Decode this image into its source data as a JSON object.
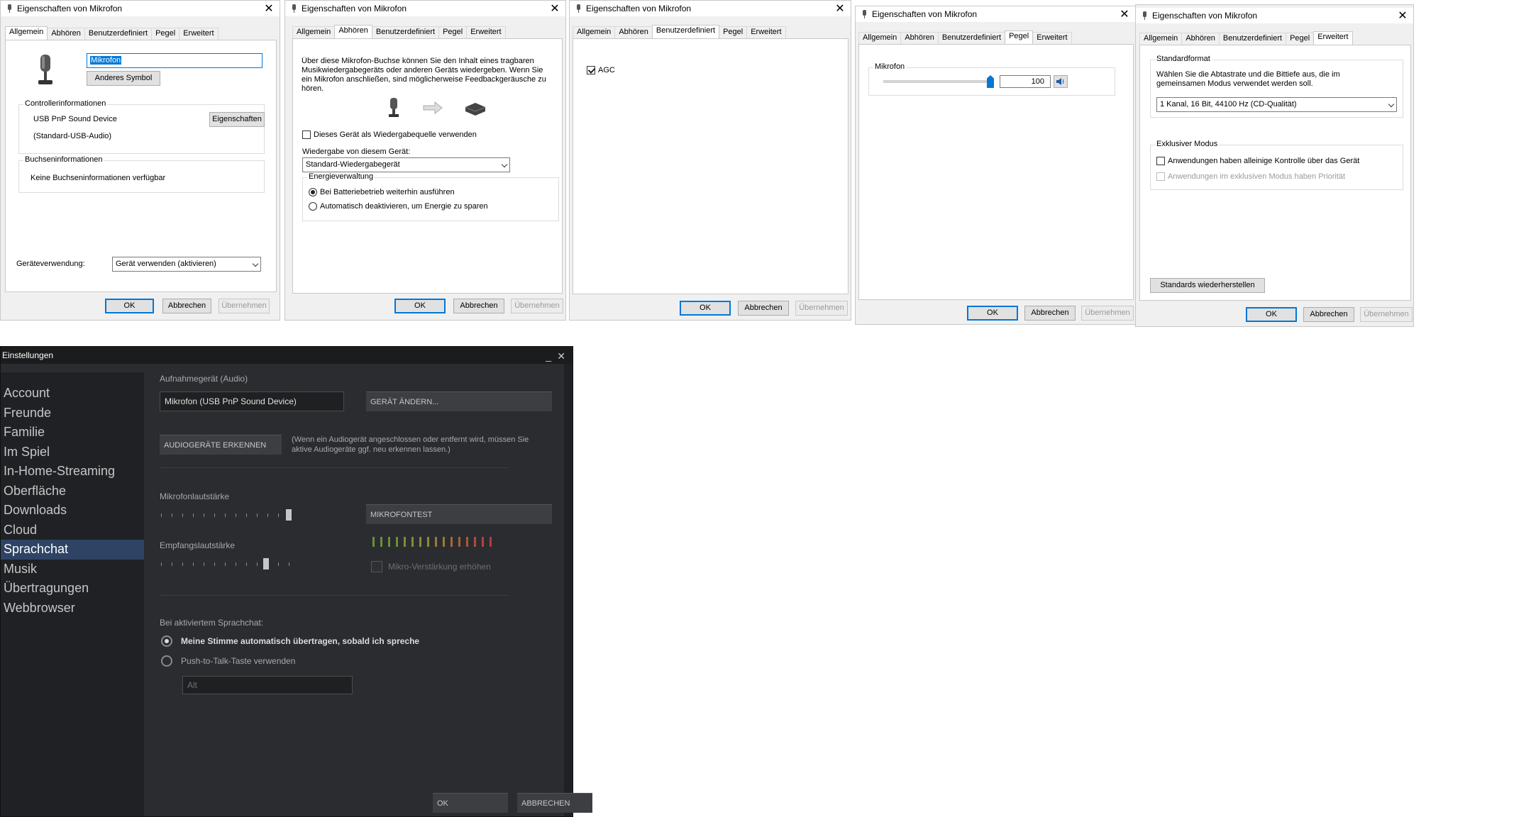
{
  "dialog_title": "Eigenschaften von Mikrofon",
  "tabs": [
    "Allgemein",
    "Abhören",
    "Benutzerdefiniert",
    "Pegel",
    "Erweitert"
  ],
  "buttons": {
    "ok": "OK",
    "cancel": "Abbrechen",
    "apply": "Übernehmen"
  },
  "general": {
    "name_value": "Mikrofon",
    "change_icon": "Anderes Symbol",
    "controller_group": "Controllerinformationen",
    "controller_name": "USB PnP Sound Device",
    "controller_driver": "(Standard-USB-Audio)",
    "properties_button": "Eigenschaften",
    "jack_group": "Buchseninformationen",
    "jack_info": "Keine Buchseninformationen verfügbar",
    "usage_label": "Geräteverwendung:",
    "usage_value": "Gerät verwenden (aktivieren)"
  },
  "listen": {
    "description": "Über diese Mikrofon-Buchse können Sie den Inhalt eines tragbaren Musikwiedergabegeräts oder anderen Geräts wiedergeben. Wenn Sie ein Mikrofon anschließen, sind möglicherweise Feedbackgeräusche zu hören.",
    "listen_checkbox": "Dieses Gerät als Wiedergabequelle verwenden",
    "playback_label": "Wiedergabe von diesem Gerät:",
    "playback_value": "Standard-Wiedergabegerät",
    "power_group": "Energieverwaltung",
    "power_option_1": "Bei Batteriebetrieb weiterhin ausführen",
    "power_option_2": "Automatisch deaktivieren, um Energie zu sparen"
  },
  "custom": {
    "agc_label": "AGC",
    "agc_checked": true
  },
  "levels": {
    "group": "Mikrofon",
    "value": "100",
    "level_fraction": 1.0
  },
  "advanced": {
    "format_group": "Standardformat",
    "format_desc": "Wählen Sie die Abtastrate und die Bittiefe aus, die im gemeinsamen Modus verwendet werden soll.",
    "format_value": "1 Kanal, 16 Bit, 44100 Hz (CD-Qualität)",
    "exclusive_group": "Exklusiver Modus",
    "exclusive_1": "Anwendungen haben alleinige Kontrolle über das Gerät",
    "exclusive_2": "Anwendungen im exklusiven Modus haben Priorität",
    "restore_button": "Standards wiederherstellen"
  },
  "steam": {
    "title": "Einstellungen",
    "minimize": "_",
    "close": "✕",
    "nav": [
      "Account",
      "Freunde",
      "Familie",
      "Im Spiel",
      "In-Home-Streaming",
      "Oberfläche",
      "Downloads",
      "Cloud",
      "Sprachchat",
      "Musik",
      "Übertragungen",
      "Webbrowser"
    ],
    "active_nav": "Sprachchat",
    "recording_label": "Aufnahmegerät (Audio)",
    "recording_value": "Mikrofon (USB PnP Sound Device)",
    "change_device": "GERÄT ÄNDERN...",
    "detect_devices": "AUDIOGERÄTE ERKENNEN",
    "detect_hint": "(Wenn ein Audiogerät angeschlossen oder entfernt wird, müssen Sie aktive Audiogeräte ggf. neu erkennen lassen.)",
    "mic_volume_label": "Mikrofonlautstärke",
    "mic_volume_fraction": 1.0,
    "mic_test": "MIKROFONTEST",
    "receive_volume_label": "Empfangslautstärke",
    "receive_volume_fraction": 0.82,
    "boost_label": "Mikro-Verstärkung erhöhen",
    "voice_label": "Bei aktiviertem Sprachchat:",
    "voice_option_1": "Meine Stimme automatisch übertragen, sobald ich spreche",
    "voice_option_2": "Push-to-Talk-Taste verwenden",
    "ptt_key": "Alt",
    "ok": "OK",
    "cancel": "ABBRECHEN"
  },
  "colors": {
    "accent": "#0078d7",
    "steam_active": "#2f4465",
    "slider_thumb": "#0078d7"
  }
}
